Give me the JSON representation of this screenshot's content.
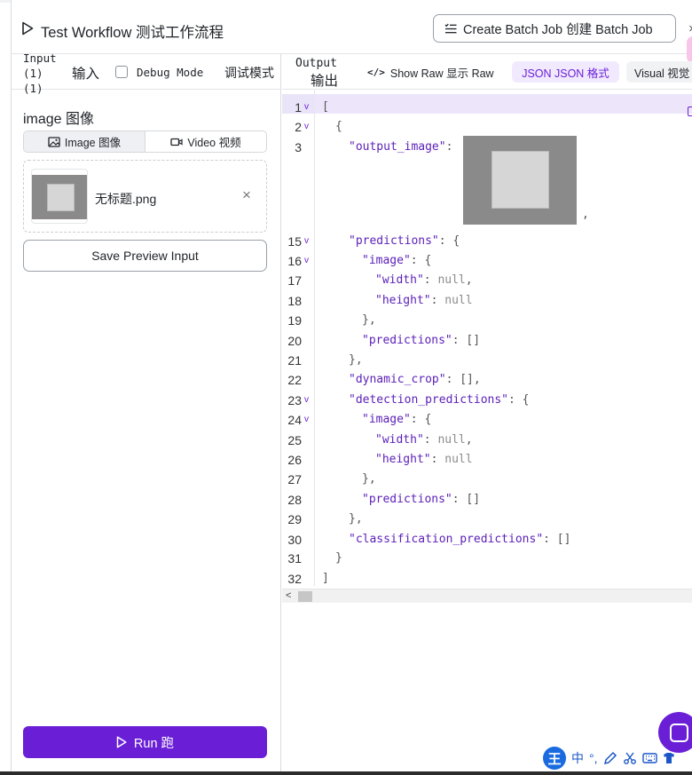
{
  "header": {
    "title": "Test Workflow  测试工作流程",
    "batch_button": "Create Batch Job   创建 Batch Job",
    "close_label": "×"
  },
  "input_panel": {
    "tab_label": "Input (1)  (1)",
    "tab_label_zh": "输入",
    "debug_mode": "Debug Mode",
    "debug_mode_zh": "调试模式",
    "debug_checked": false,
    "field_label": "image  图像",
    "source_tabs": [
      {
        "label": "Image   图像",
        "active": true,
        "icon": "image-icon"
      },
      {
        "label": "Video   视频",
        "active": false,
        "icon": "video-icon"
      }
    ],
    "file": {
      "name": "无标题.png",
      "remove_label": "×"
    },
    "save_preview_label": "Save Preview Input",
    "run_label": "Run  跑"
  },
  "output_panel": {
    "tab_label": "Output",
    "tab_label_zh": "输出",
    "show_raw_icon": "</>",
    "show_raw_label": "Show Raw   显示 Raw",
    "json_label": "JSON   JSON 格式",
    "visual_label": "Visual   视觉",
    "accent": "#6a1fd6",
    "lines": [
      {
        "n": "1",
        "fold": true,
        "indent": 0,
        "parts": [
          [
            "p",
            "["
          ]
        ]
      },
      {
        "n": "2",
        "fold": true,
        "indent": 1,
        "parts": [
          [
            "p",
            "{"
          ]
        ]
      },
      {
        "n": "3",
        "fold": false,
        "indent": 2,
        "parts": [
          [
            "k",
            "\"output_image\""
          ],
          [
            "p",
            ": "
          ]
        ]
      },
      {
        "n": "15",
        "fold": true,
        "indent": 2,
        "parts": [
          [
            "k",
            "\"predictions\""
          ],
          [
            "p",
            ": {"
          ]
        ]
      },
      {
        "n": "16",
        "fold": true,
        "indent": 3,
        "parts": [
          [
            "k",
            "\"image\""
          ],
          [
            "p",
            ": {"
          ]
        ]
      },
      {
        "n": "17",
        "fold": false,
        "indent": 4,
        "parts": [
          [
            "k",
            "\"width\""
          ],
          [
            "p",
            ": "
          ],
          [
            "n",
            "null"
          ],
          [
            "p",
            ","
          ]
        ]
      },
      {
        "n": "18",
        "fold": false,
        "indent": 4,
        "parts": [
          [
            "k",
            "\"height\""
          ],
          [
            "p",
            ": "
          ],
          [
            "n",
            "null"
          ]
        ]
      },
      {
        "n": "19",
        "fold": false,
        "indent": 3,
        "parts": [
          [
            "p",
            "},"
          ]
        ]
      },
      {
        "n": "20",
        "fold": false,
        "indent": 3,
        "parts": [
          [
            "k",
            "\"predictions\""
          ],
          [
            "p",
            ": []"
          ]
        ]
      },
      {
        "n": "21",
        "fold": false,
        "indent": 2,
        "parts": [
          [
            "p",
            "},"
          ]
        ]
      },
      {
        "n": "22",
        "fold": false,
        "indent": 2,
        "parts": [
          [
            "k",
            "\"dynamic_crop\""
          ],
          [
            "p",
            ": [],"
          ]
        ]
      },
      {
        "n": "23",
        "fold": true,
        "indent": 2,
        "parts": [
          [
            "k",
            "\"detection_predictions\""
          ],
          [
            "p",
            ": {"
          ]
        ]
      },
      {
        "n": "24",
        "fold": true,
        "indent": 3,
        "parts": [
          [
            "k",
            "\"image\""
          ],
          [
            "p",
            ": {"
          ]
        ]
      },
      {
        "n": "25",
        "fold": false,
        "indent": 4,
        "parts": [
          [
            "k",
            "\"width\""
          ],
          [
            "p",
            ": "
          ],
          [
            "n",
            "null"
          ],
          [
            "p",
            ","
          ]
        ]
      },
      {
        "n": "26",
        "fold": false,
        "indent": 4,
        "parts": [
          [
            "k",
            "\"height\""
          ],
          [
            "p",
            ": "
          ],
          [
            "n",
            "null"
          ]
        ]
      },
      {
        "n": "27",
        "fold": false,
        "indent": 3,
        "parts": [
          [
            "p",
            "},"
          ]
        ]
      },
      {
        "n": "28",
        "fold": false,
        "indent": 3,
        "parts": [
          [
            "k",
            "\"predictions\""
          ],
          [
            "p",
            ": []"
          ]
        ]
      },
      {
        "n": "29",
        "fold": false,
        "indent": 2,
        "parts": [
          [
            "p",
            "},"
          ]
        ]
      },
      {
        "n": "30",
        "fold": false,
        "indent": 2,
        "parts": [
          [
            "k",
            "\"classification_predictions\""
          ],
          [
            "p",
            ": []"
          ]
        ]
      },
      {
        "n": "31",
        "fold": false,
        "indent": 1,
        "parts": [
          [
            "p",
            "}"
          ]
        ]
      },
      {
        "n": "32",
        "fold": false,
        "indent": 0,
        "parts": [
          [
            "p",
            "]"
          ]
        ]
      }
    ],
    "image_comma": ","
  },
  "ime_toolbar": {
    "logo": "王",
    "mode": "中",
    "punct": "°,"
  }
}
